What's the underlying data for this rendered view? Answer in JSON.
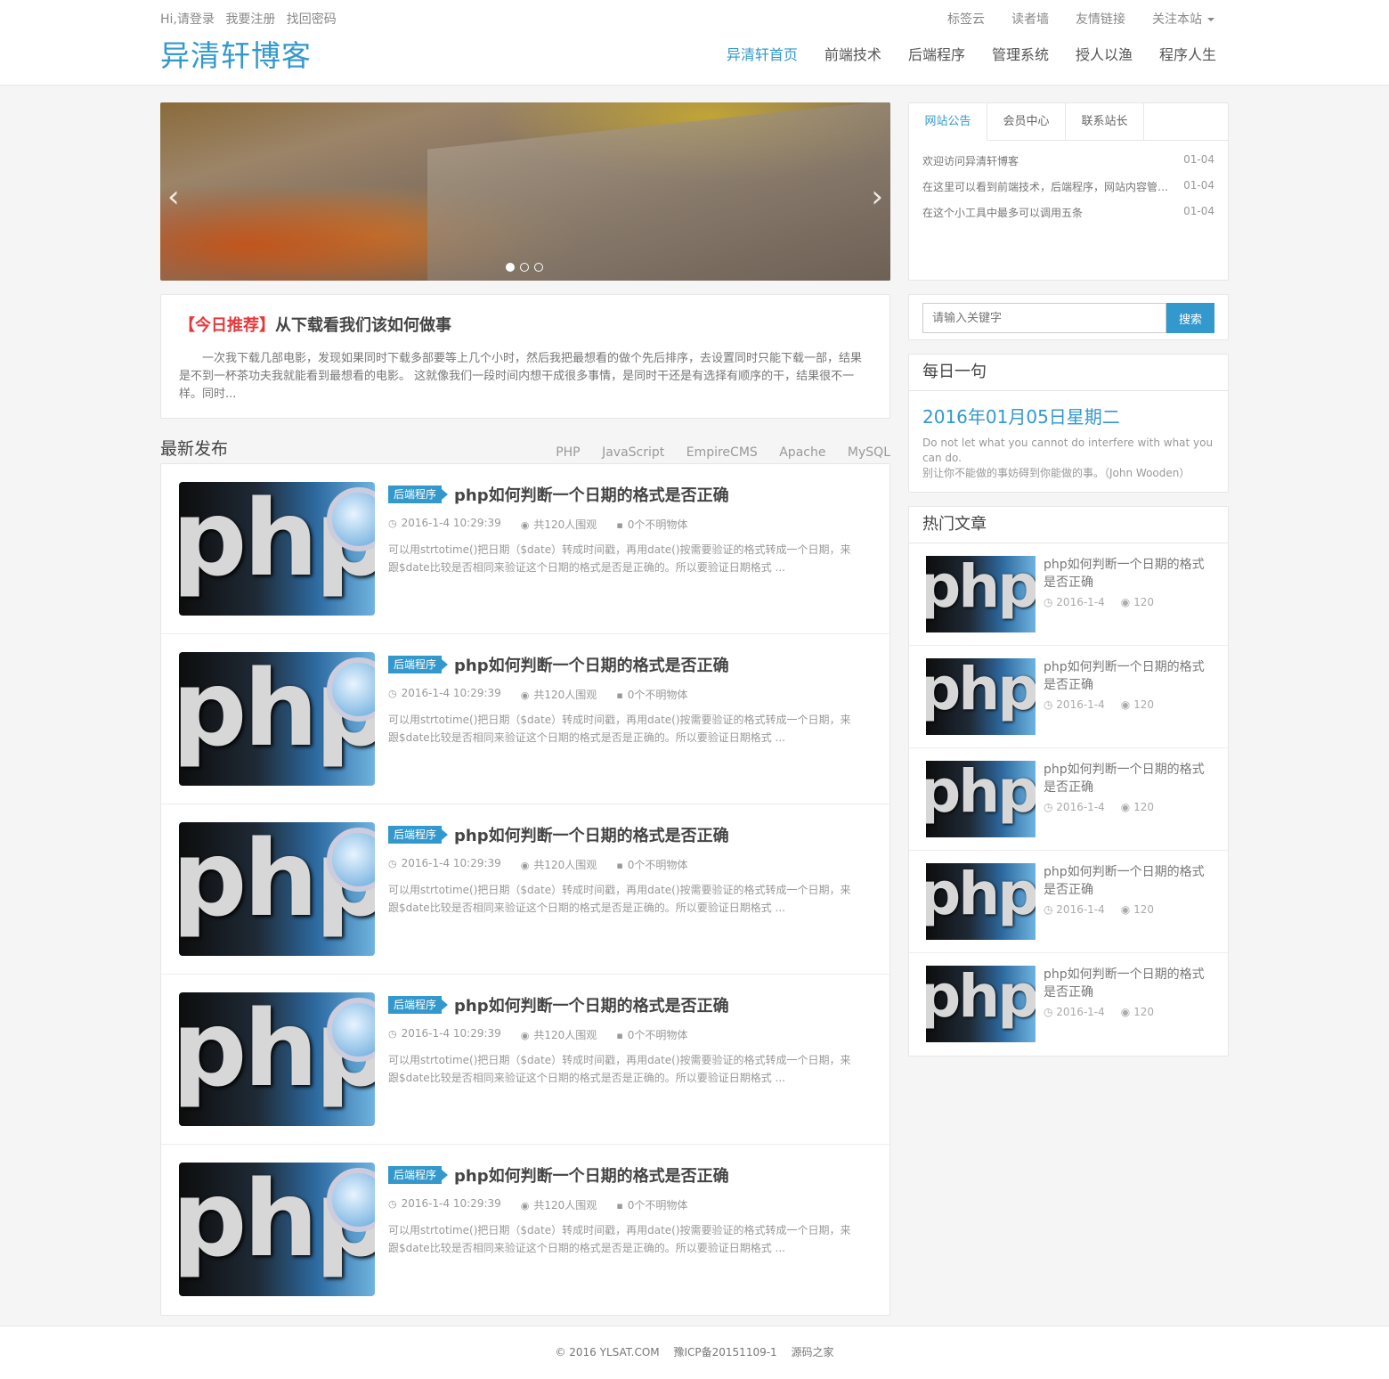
{
  "topbar": {
    "links": [
      "Hi,请登录",
      "我要注册",
      "找回密码"
    ],
    "right": [
      "标签云",
      "读者墙",
      "友情链接",
      "关注本站"
    ]
  },
  "brand": "异清轩博客",
  "nav": [
    "异清轩首页",
    "前端技术",
    "后端程序",
    "管理系统",
    "授人以渔",
    "程序人生"
  ],
  "slider": {
    "prev": "‹",
    "next": "›"
  },
  "recommend": {
    "tag": "【今日推荐】",
    "title": "从下载看我们该如何做事",
    "text": "一次我下载几部电影，发现如果同时下载多部要等上几个小时，然后我把最想看的做个先后排序，去设置同时只能下载一部，结果是不到一杯茶功夫我就能看到最想看的电影。 这就像我们一段时间内想干成很多事情，是同时干还是有选择有顺序的干，结果很不一样。同时..."
  },
  "latest": {
    "heading": "最新发布",
    "tags": [
      "PHP",
      "JavaScript",
      "EmpireCMS",
      "Apache",
      "MySQL"
    ],
    "items": [
      {
        "category": "后端程序",
        "title": "php如何判断一个日期的格式是否正确",
        "date": "2016-1-4 10:29:39",
        "views": "共120人围观",
        "comments": "0个不明物体",
        "excerpt": "可以用strtotime()把日期（$date）转成时间戳，再用date()按需要验证的格式转成一个日期，来跟$date比较是否相同来验证这个日期的格式是否是正确的。所以要验证日期格式 ...",
        "thumb": "php"
      },
      {
        "category": "后端程序",
        "title": "php如何判断一个日期的格式是否正确",
        "date": "2016-1-4 10:29:39",
        "views": "共120人围观",
        "comments": "0个不明物体",
        "excerpt": "可以用strtotime()把日期（$date）转成时间戳，再用date()按需要验证的格式转成一个日期，来跟$date比较是否相同来验证这个日期的格式是否是正确的。所以要验证日期格式 ...",
        "thumb": "php"
      },
      {
        "category": "后端程序",
        "title": "php如何判断一个日期的格式是否正确",
        "date": "2016-1-4 10:29:39",
        "views": "共120人围观",
        "comments": "0个不明物体",
        "excerpt": "可以用strtotime()把日期（$date）转成时间戳，再用date()按需要验证的格式转成一个日期，来跟$date比较是否相同来验证这个日期的格式是否是正确的。所以要验证日期格式 ...",
        "thumb": "php"
      },
      {
        "category": "后端程序",
        "title": "php如何判断一个日期的格式是否正确",
        "date": "2016-1-4 10:29:39",
        "views": "共120人围观",
        "comments": "0个不明物体",
        "excerpt": "可以用strtotime()把日期（$date）转成时间戳，再用date()按需要验证的格式转成一个日期，来跟$date比较是否相同来验证这个日期的格式是否是正确的。所以要验证日期格式 ...",
        "thumb": "php"
      },
      {
        "category": "后端程序",
        "title": "php如何判断一个日期的格式是否正确",
        "date": "2016-1-4 10:29:39",
        "views": "共120人围观",
        "comments": "0个不明物体",
        "excerpt": "可以用strtotime()把日期（$date）转成时间戳，再用date()按需要验证的格式转成一个日期，来跟$date比较是否相同来验证这个日期的格式是否是正确的。所以要验证日期格式 ...",
        "thumb": "php"
      }
    ]
  },
  "tabs": {
    "labels": [
      "网站公告",
      "会员中心",
      "联系站长"
    ],
    "notices": [
      {
        "text": "欢迎访问异清轩博客",
        "date": "01-04"
      },
      {
        "text": "在这里可以看到前端技术，后端程序，网站内容管理系统等文章，还有我的程序人生！！！",
        "date": "01-04"
      },
      {
        "text": "在这个小工具中最多可以调用五条",
        "date": "01-04"
      }
    ]
  },
  "search": {
    "placeholder": "请输入关键字",
    "button": "搜索"
  },
  "daily": {
    "heading": "每日一句",
    "date": "2016年01月05日星期二",
    "en": "Do not let what you cannot do interfere with what you can do.",
    "cn": "别让你不能做的事妨碍到你能做的事。（John Wooden）"
  },
  "hot": {
    "heading": "热门文章",
    "items": [
      {
        "title": "php如何判断一个日期的格式是否正确",
        "date": "2016-1-4",
        "views": "120",
        "thumb": "php"
      },
      {
        "title": "php如何判断一个日期的格式是否正确",
        "date": "2016-1-4",
        "views": "120",
        "thumb": "php"
      },
      {
        "title": "php如何判断一个日期的格式是否正确",
        "date": "2016-1-4",
        "views": "120",
        "thumb": "php"
      },
      {
        "title": "php如何判断一个日期的格式是否正确",
        "date": "2016-1-4",
        "views": "120",
        "thumb": "php"
      },
      {
        "title": "php如何判断一个日期的格式是否正确",
        "date": "2016-1-4",
        "views": "120",
        "thumb": "php"
      }
    ]
  },
  "footer": [
    "© 2016 YLSAT.COM",
    "豫ICP备20151109-1",
    "源码之家"
  ],
  "icons": {
    "clock": "clock-icon",
    "eye": "eye-icon",
    "comment": "comment-icon"
  },
  "colors": {
    "accent": "#3399cc",
    "highlight": "#e4393c"
  }
}
